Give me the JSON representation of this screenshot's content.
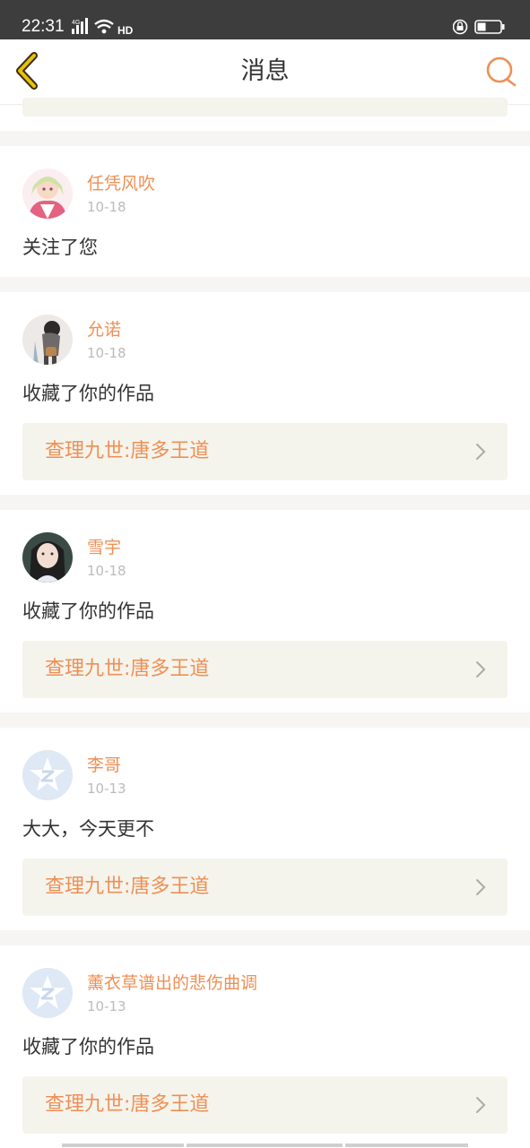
{
  "status_bar": {
    "time": "22:31",
    "network": "4G",
    "hd": "HD"
  },
  "header": {
    "title": "消息",
    "back_icon": "chevron-left-icon",
    "search_icon": "search-icon"
  },
  "colors": {
    "accent": "#ef8f55",
    "back_arrow": "#d8b500",
    "work_link_bg": "#f5f4ec"
  },
  "messages": [
    {
      "username": "任凭风吹",
      "date": "10-18",
      "text": "关注了您",
      "avatar": "anime-girl-avatar"
    },
    {
      "username": "允诺",
      "date": "10-18",
      "text": "收藏了你的作品",
      "work": "查理九世:唐多王道",
      "avatar": "girl-with-bag-avatar"
    },
    {
      "username": "雪宇",
      "date": "10-18",
      "text": "收藏了你的作品",
      "work": "查理九世:唐多王道",
      "avatar": "person-photo-avatar"
    },
    {
      "username": "李哥",
      "date": "10-13",
      "text": "大大，今天更不",
      "work": "查理九世:唐多王道",
      "avatar": "default-star-avatar"
    },
    {
      "username": "薰衣草谱出的悲伤曲调",
      "date": "10-13",
      "text": "收藏了你的作品",
      "work": "查理九世:唐多王道",
      "avatar": "default-star-avatar"
    }
  ]
}
